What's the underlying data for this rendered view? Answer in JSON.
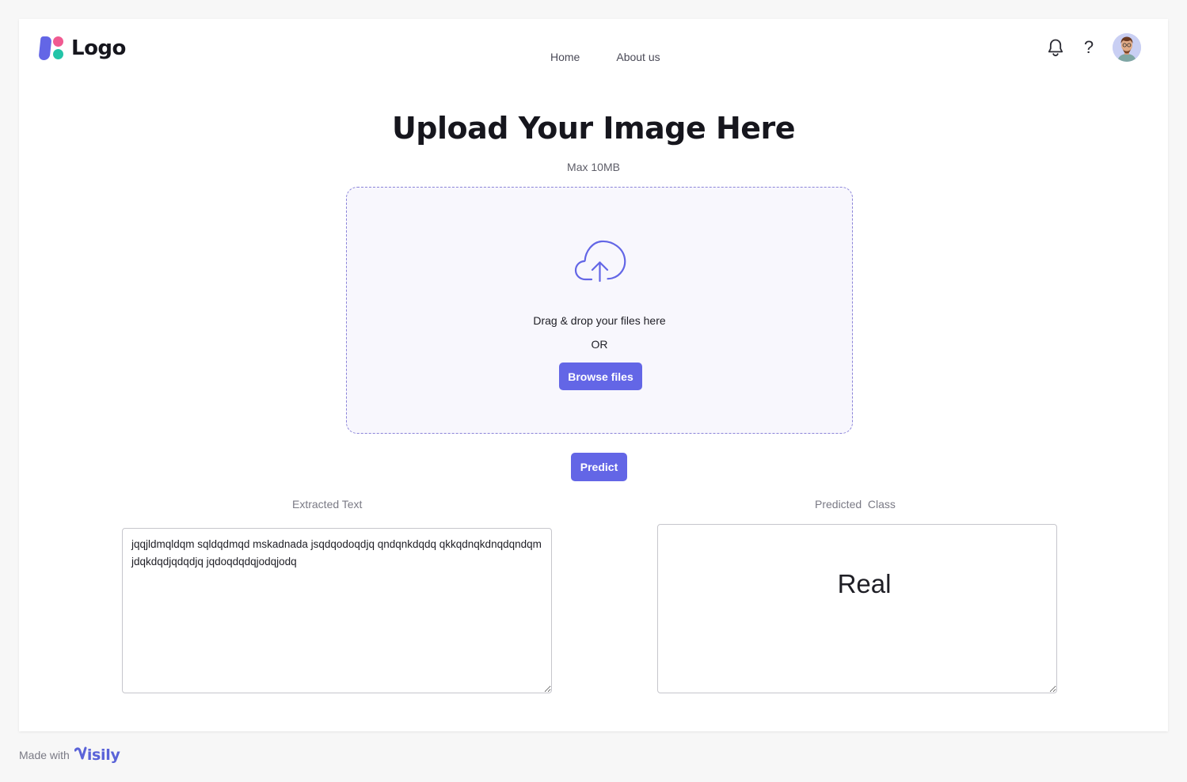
{
  "header": {
    "logo_text": "Logo",
    "nav": [
      {
        "label": "Home"
      },
      {
        "label": "About us"
      }
    ],
    "help_label": "?",
    "icons": {
      "notifications": "bell-icon",
      "help": "question-icon",
      "avatar": "user-avatar"
    }
  },
  "main": {
    "title": "Upload Your Image Here",
    "subtitle": "Max 10MB",
    "dropzone": {
      "icon": "cloud-upload-icon",
      "text": "Drag & drop your files here",
      "or_text": "OR",
      "browse_label": "Browse files"
    },
    "predict_label": "Predict",
    "extracted": {
      "label": "Extracted Text",
      "value": "jqqjldmqldqm sqldqdmqd mskadnada jsqdqodoqdjq qndqnkdqdq qkkqdnqkdnqdqndqm jdqkdqdjqdqdjq jqdoqdqdqjodqjodq"
    },
    "predicted": {
      "label": "Predicted  Class",
      "value": "Real"
    }
  },
  "footer": {
    "made_with": "Made with",
    "brand": "isily"
  },
  "colors": {
    "accent": "#6366e6",
    "dropzone_bg": "#f8f7fd",
    "dropzone_border": "#8b84d9",
    "logo_pink": "#f05a91",
    "logo_teal": "#23c4a8"
  }
}
